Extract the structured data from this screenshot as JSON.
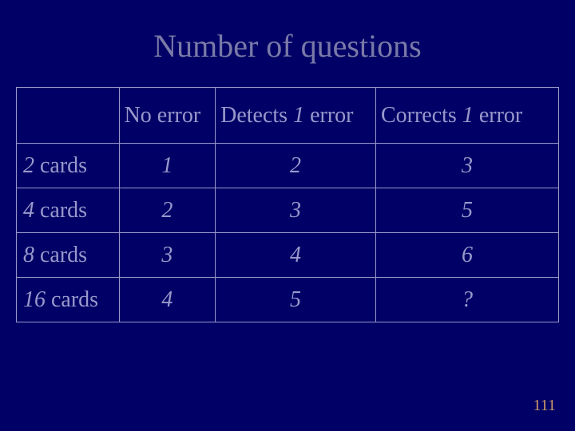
{
  "title": "Number of questions",
  "headers": {
    "blank": "",
    "col1": "No error",
    "col2_prefix": "Detects ",
    "col2_num": "1",
    "col2_suffix": " error",
    "col3_prefix": "Corrects ",
    "col3_num": "1",
    "col3_suffix": " error"
  },
  "rows": [
    {
      "label_num": "2",
      "label_word": " cards",
      "c1": "1",
      "c2": "2",
      "c3": "3"
    },
    {
      "label_num": "4",
      "label_word": " cards",
      "c1": "2",
      "c2": "3",
      "c3": "5"
    },
    {
      "label_num": "8",
      "label_word": " cards",
      "c1": "3",
      "c2": "4",
      "c3": "6"
    },
    {
      "label_num": "16",
      "label_word": " cards",
      "c1": "4",
      "c2": "5",
      "c3": "?"
    }
  ],
  "page_number": "111"
}
